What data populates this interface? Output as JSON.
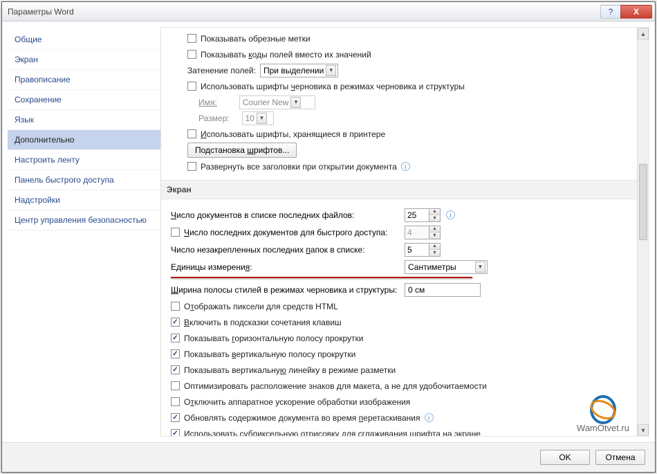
{
  "window": {
    "title": "Параметры Word"
  },
  "titlebar": {
    "help": "?",
    "close": "X"
  },
  "sidebar": {
    "items": [
      {
        "label": "Общие"
      },
      {
        "label": "Экран"
      },
      {
        "label": "Правописание"
      },
      {
        "label": "Сохранение"
      },
      {
        "label": "Язык"
      },
      {
        "label": "Дополнительно",
        "active": true
      },
      {
        "label": "Настроить ленту"
      },
      {
        "label": "Панель быстрого доступа"
      },
      {
        "label": "Надстройки"
      },
      {
        "label": "Центр управления безопасностью"
      }
    ]
  },
  "top": {
    "crop_marks": "Показывать обрезные метки",
    "field_codes": "Показывать коды полей вместо их значений",
    "field_codes_u": "к",
    "shading_label": "Затенение полей:",
    "shading_value": "При выделении",
    "draft_font": "Использовать шрифты черновика в режимах черновика и структуры",
    "draft_font_u": "ч",
    "name_label": "Имя:",
    "name_value": "Courier New",
    "size_label": "Размер:",
    "size_value": "10",
    "printer_fonts": "Использовать шрифты, хранящиеся в принтере",
    "printer_fonts_u": "И",
    "font_sub_btn": "Подстановка шрифтов...",
    "font_sub_u": "ш",
    "expand_headers": "Развернуть все заголовки при открытии документа"
  },
  "section": {
    "screen": "Экран"
  },
  "screen": {
    "recent_count_label": "Число документов в списке последних файлов:",
    "recent_count_u": "Ч",
    "recent_count_value": "25",
    "quick_count_label": "Число последних документов для быстрого доступа:",
    "quick_count_u": "Ч",
    "quick_count_value": "4",
    "folders_label": "Число незакрепленных последних папок в списке:",
    "folders_u": "п",
    "folders_value": "5",
    "units_label": "Единицы измерения:",
    "units_u": "я",
    "units_value": "Сантиметры",
    "style_width_label": "Ширина полосы стилей в режимах черновика и структуры:",
    "style_width_u": "Ш",
    "style_width_value": "0 см",
    "html_pixels": "Отображать пиксели для средств HTML",
    "html_pixels_u": "т",
    "tooltips_keys": "Включить в подсказки сочетания клавиш",
    "tooltips_keys_u": "В",
    "hscroll": "Показывать горизонтальную полосу прокрутки",
    "hscroll_u": "г",
    "vscroll": "Показывать вертикальную полосу прокрутки",
    "vscroll_u": "в",
    "vruler": "Показывать вертикальную линейку в режиме разметки",
    "vruler_u": "ю",
    "optimize_layout": "Оптимизировать расположение знаков для макета, а не для удобочитаемости",
    "hw_accel": "Отключить аппаратное ускорение обработки изображения",
    "hw_accel_u": "т",
    "drag_update": "Обновлять содержимое документа во время перетаскивания",
    "drag_update_u": "п",
    "subpixel": "Использовать субпиксельную отрисовку для сглаживания шрифта на экране"
  },
  "footer": {
    "ok": "OK",
    "cancel": "Отмена"
  },
  "watermark": "WamOtvet.ru"
}
